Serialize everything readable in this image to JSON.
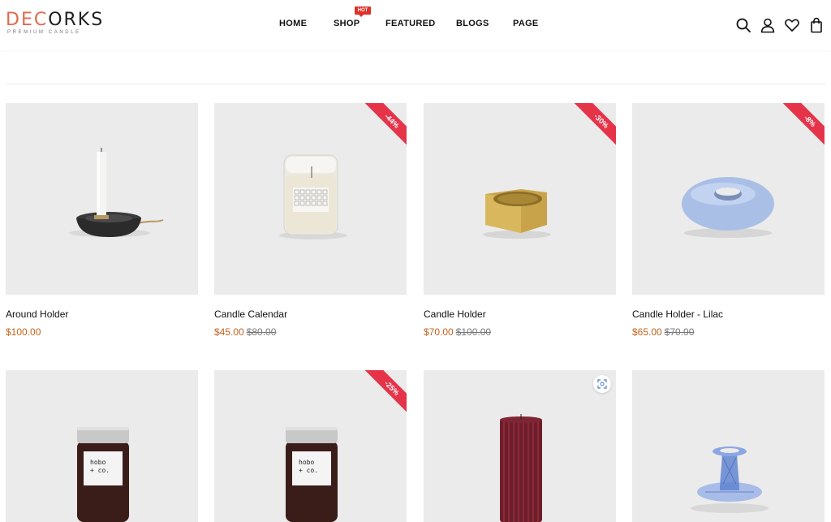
{
  "brand": {
    "logo_part1": "DEC",
    "logo_part2": "ORKS",
    "tagline": "PREMIUM CANDLE",
    "accent_color": "#e06a4e"
  },
  "nav": {
    "items": [
      {
        "label": "HOME"
      },
      {
        "label": "SHOP"
      },
      {
        "label": "FEATURED"
      },
      {
        "label": "BLOGS"
      },
      {
        "label": "PAGE"
      }
    ],
    "hot_badge": "HOT"
  },
  "header_icons": [
    "search-icon",
    "account-icon",
    "wishlist-icon",
    "cart-icon"
  ],
  "products": [
    {
      "name": "Around Holder",
      "price": "$100.00",
      "old_price": "",
      "discount": ""
    },
    {
      "name": "Candle Calendar",
      "price": "$45.00",
      "old_price": "$80.00",
      "discount": "-44%"
    },
    {
      "name": "Candle Holder",
      "price": "$70.00",
      "old_price": "$100.00",
      "discount": "-30%"
    },
    {
      "name": "Candle Holder - Lilac",
      "price": "$65.00",
      "old_price": "$70.00",
      "discount": "-8%"
    },
    {
      "name": "",
      "price": "",
      "old_price": "",
      "discount": ""
    },
    {
      "name": "",
      "price": "",
      "old_price": "",
      "discount": "-25%"
    },
    {
      "name": "",
      "price": "",
      "old_price": "",
      "discount": ""
    },
    {
      "name": "",
      "price": "",
      "old_price": "",
      "discount": ""
    }
  ],
  "jar_label": {
    "line1": "hobo",
    "line2": "+ co."
  },
  "colors": {
    "price": "#c1621c",
    "sale_ribbon": "#e5344a",
    "hot_badge": "#e0312a",
    "thumb_bg": "#ebebeb"
  }
}
